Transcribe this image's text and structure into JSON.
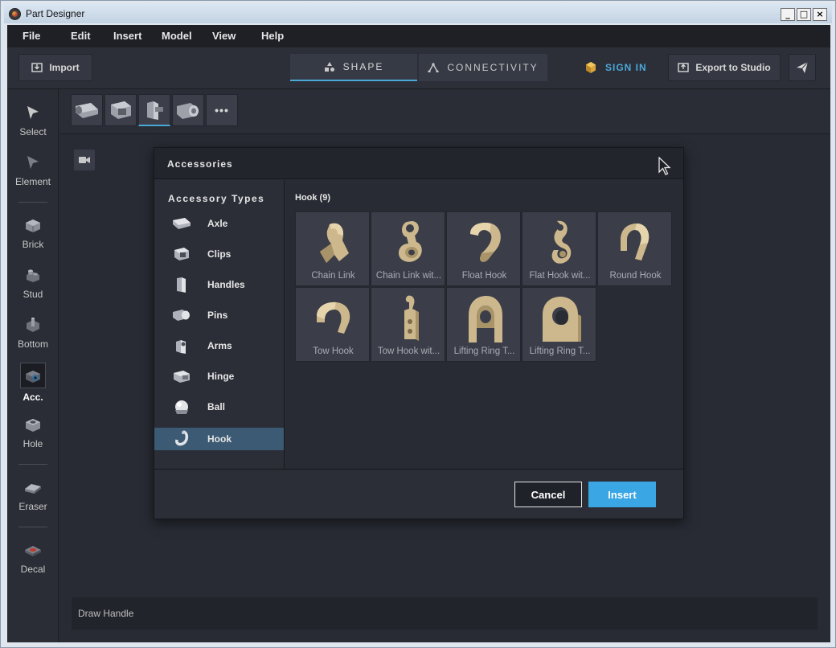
{
  "window": {
    "title": "Part Designer",
    "minimize": "_",
    "maximize": "□",
    "close": "×"
  },
  "menu": [
    "File",
    "Edit",
    "Insert",
    "Model",
    "View",
    "Help"
  ],
  "toolbar": {
    "import_label": "Import",
    "tabs": [
      {
        "label": "SHAPE",
        "icon": "shapes-icon",
        "active": true
      },
      {
        "label": "CONNECTIVITY",
        "icon": "connectivity-icon",
        "active": false
      }
    ],
    "sign_in_label": "SIGN IN",
    "export_label": "Export to Studio"
  },
  "rail": [
    {
      "label": "Select",
      "icon": "cursor-icon"
    },
    {
      "label": "Element",
      "icon": "element-cursor-icon"
    },
    {
      "label": "Brick",
      "icon": "brick-icon"
    },
    {
      "label": "Stud",
      "icon": "stud-icon"
    },
    {
      "label": "Bottom",
      "icon": "bottom-icon"
    },
    {
      "label": "Acc.",
      "icon": "accessory-icon",
      "active": true
    },
    {
      "label": "Hole",
      "icon": "hole-icon"
    },
    {
      "label": "Eraser",
      "icon": "eraser-icon"
    },
    {
      "label": "Decal",
      "icon": "decal-icon"
    }
  ],
  "subbar": {
    "more_label": "•••"
  },
  "dialog": {
    "title": "Accessories",
    "types_title": "Accessory Types",
    "types": [
      {
        "label": "Axle",
        "icon": "axle-icon"
      },
      {
        "label": "Clips",
        "icon": "clips-icon"
      },
      {
        "label": "Handles",
        "icon": "handles-icon"
      },
      {
        "label": "Pins",
        "icon": "pins-icon"
      },
      {
        "label": "Arms",
        "icon": "arms-icon"
      },
      {
        "label": "Hinge",
        "icon": "hinge-icon"
      },
      {
        "label": "Ball",
        "icon": "ball-icon"
      },
      {
        "label": "Hook",
        "icon": "hook-icon",
        "active": true
      }
    ],
    "content_title": "Hook (9)",
    "items": [
      {
        "label": "Chain Link",
        "icon": "chain-link-icon"
      },
      {
        "label": "Chain Link wit...",
        "icon": "chain-link-with-hole-icon"
      },
      {
        "label": "Float Hook",
        "icon": "float-hook-icon"
      },
      {
        "label": "Flat Hook wit...",
        "icon": "flat-hook-icon"
      },
      {
        "label": "Round Hook",
        "icon": "round-hook-icon"
      },
      {
        "label": "Tow Hook",
        "icon": "tow-hook-icon"
      },
      {
        "label": "Tow Hook wit...",
        "icon": "tow-hook-with-holes-icon"
      },
      {
        "label": "Lifting Ring T...",
        "icon": "lifting-ring-icon"
      },
      {
        "label": "Lifting Ring T...",
        "icon": "lifting-ring-thick-icon"
      }
    ],
    "cancel_label": "Cancel",
    "insert_label": "Insert"
  },
  "status": {
    "text": "Draw Handle"
  },
  "colors": {
    "accent": "#3aa7e4",
    "sign_in": "#4aa8d8",
    "selected_type": "#3d5a74",
    "part": "#c9b48a"
  }
}
